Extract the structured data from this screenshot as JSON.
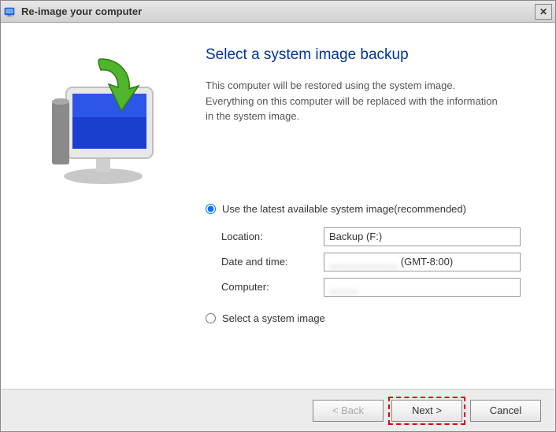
{
  "titlebar": {
    "title": "Re-image your computer"
  },
  "main": {
    "heading": "Select a system image backup",
    "description": "This computer will be restored using the system image. Everything on this computer will be replaced with the information in the system image."
  },
  "options": {
    "use_latest_label": "Use the latest available system image(recommended)",
    "select_image_label": "Select a system image",
    "selected": "use_latest",
    "details": {
      "location_label": "Location:",
      "location_value": "Backup (F:)",
      "datetime_label": "Date and time:",
      "datetime_value_obscured": "____________",
      "datetime_tz": "(GMT-8:00)",
      "computer_label": "Computer:",
      "computer_value_obscured": "_____"
    }
  },
  "buttons": {
    "back": "< Back",
    "next": "Next >",
    "cancel": "Cancel"
  }
}
